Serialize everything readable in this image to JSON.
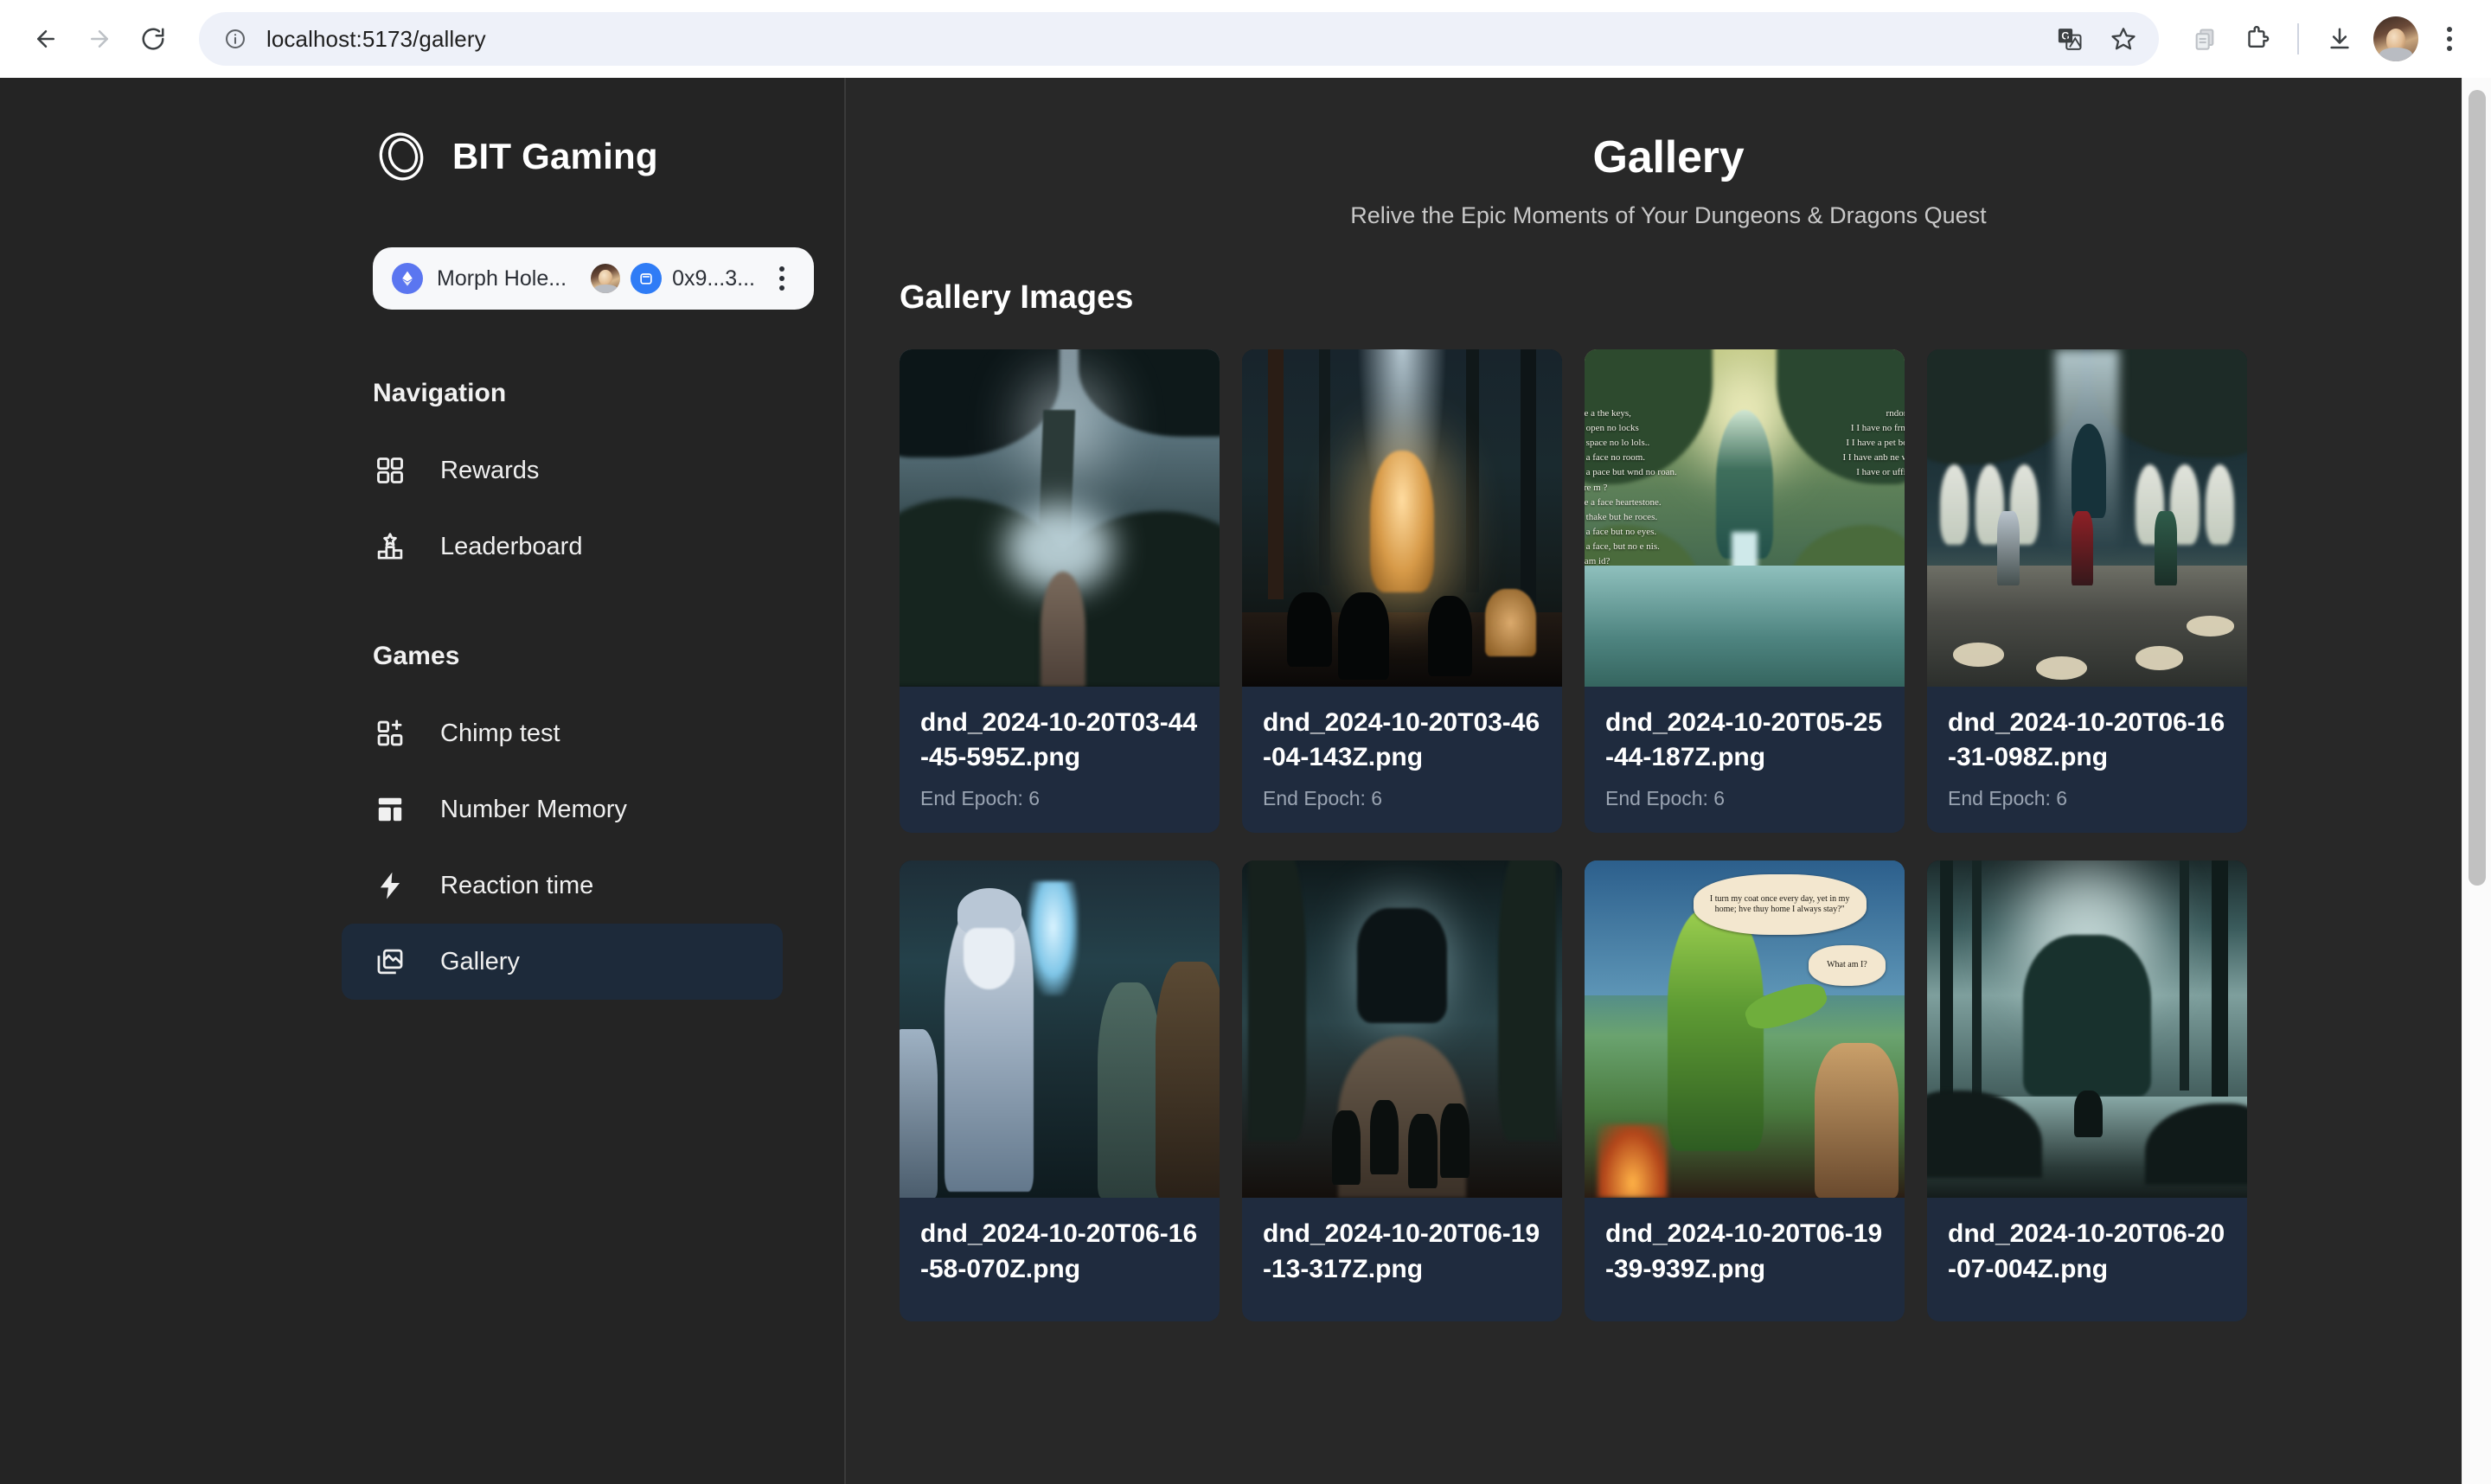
{
  "browser": {
    "url": "localhost:5173/gallery",
    "back_label": "Back",
    "forward_label": "Forward",
    "reload_label": "Reload",
    "site_info_label": "View site information",
    "translate_label": "Translate this page",
    "bookmark_label": "Bookmark this tab",
    "copy_label": "Copy",
    "extensions_label": "Extensions",
    "downloads_label": "Downloads",
    "profile_label": "Profile",
    "menu_label": "Customize and control Google Chrome"
  },
  "sidebar": {
    "brand": "BIT Gaming",
    "wallet": {
      "chain": "Morph Hole...",
      "address": "0x9...3...",
      "menu_label": "Wallet options"
    },
    "sections": [
      {
        "title": "Navigation",
        "items": [
          {
            "label": "Rewards",
            "icon": "grid-icon",
            "active": false
          },
          {
            "label": "Leaderboard",
            "icon": "podium-icon",
            "active": false
          }
        ]
      },
      {
        "title": "Games",
        "items": [
          {
            "label": "Chimp test",
            "icon": "grid-plus-icon",
            "active": false
          },
          {
            "label": "Number Memory",
            "icon": "layout-icon",
            "active": false
          },
          {
            "label": "Reaction time",
            "icon": "bolt-icon",
            "active": false
          },
          {
            "label": "Gallery",
            "icon": "images-icon",
            "active": true
          }
        ]
      }
    ]
  },
  "main": {
    "title": "Gallery",
    "subtitle": "Relive the Epic Moments of Your Dungeons & Dragons Quest",
    "section_title": "Gallery Images",
    "meta_prefix": "End Epoch: ",
    "cards": [
      {
        "filename": "dnd_2024-10-20T03-44-45-595Z.png",
        "meta": "End Epoch: 6",
        "art": "t1",
        "alt": "haunted-tree-misty-path"
      },
      {
        "filename": "dnd_2024-10-20T03-46-04-143Z.png",
        "meta": "End Epoch: 6",
        "art": "t2",
        "alt": "glowing-figure-with-dogs"
      },
      {
        "filename": "dnd_2024-10-20T05-25-44-187Z.png",
        "meta": "End Epoch: 6",
        "art": "t3",
        "alt": "green-glade-riddle-spirit"
      },
      {
        "filename": "dnd_2024-10-20T06-16-31-098Z.png",
        "meta": "End Epoch: 6",
        "art": "t4",
        "alt": "board-game-heroes-and-ghosts"
      },
      {
        "filename": "dnd_2024-10-20T06-16-58-070Z.png",
        "meta": "",
        "art": "t5",
        "alt": "wizard-summoning-spirit"
      },
      {
        "filename": "dnd_2024-10-20T06-19-13-317Z.png",
        "meta": "",
        "art": "t6",
        "alt": "party-approaching-forest-beast"
      },
      {
        "filename": "dnd_2024-10-20T06-19-39-939Z.png",
        "meta": "",
        "art": "t7",
        "alt": "swamp-creature-riddle"
      },
      {
        "filename": "dnd_2024-10-20T06-20-07-004Z.png",
        "meta": "",
        "art": "t8",
        "alt": "moss-giant-over-swamp"
      }
    ],
    "riddle_lines_left": [
      "ve a  the keys,",
      "e open  no locks",
      "e space  no lo lols..",
      "e a face  no room.",
      "e a pace but wnd no roan.",
      "are m ?",
      "ve a  face  heartestone.",
      "e thake but  he roces.",
      "e a face but  no eyes.",
      "e a face,  but  no e nis.",
      "t am  id?"
    ],
    "riddle_lines_right": [
      "rndore.",
      "I  I have no frnrd",
      "I  I have a pet bo r",
      "I  I have anb ne wo",
      "I   have or uffib,"
    ],
    "bubble_main": "I turn my coat once every day, yet in my home; hve thuy home  I always stay?\"",
    "bubble_small": "What am I?"
  },
  "colors": {
    "app_background": "#242424",
    "main_background": "#282828",
    "card_background": "#1f2b3e",
    "sidebar_active": "#1d2a3a",
    "accent_blue": "#2f7cf6",
    "text_primary": "#ffffff",
    "text_muted": "#9aa4b2"
  }
}
